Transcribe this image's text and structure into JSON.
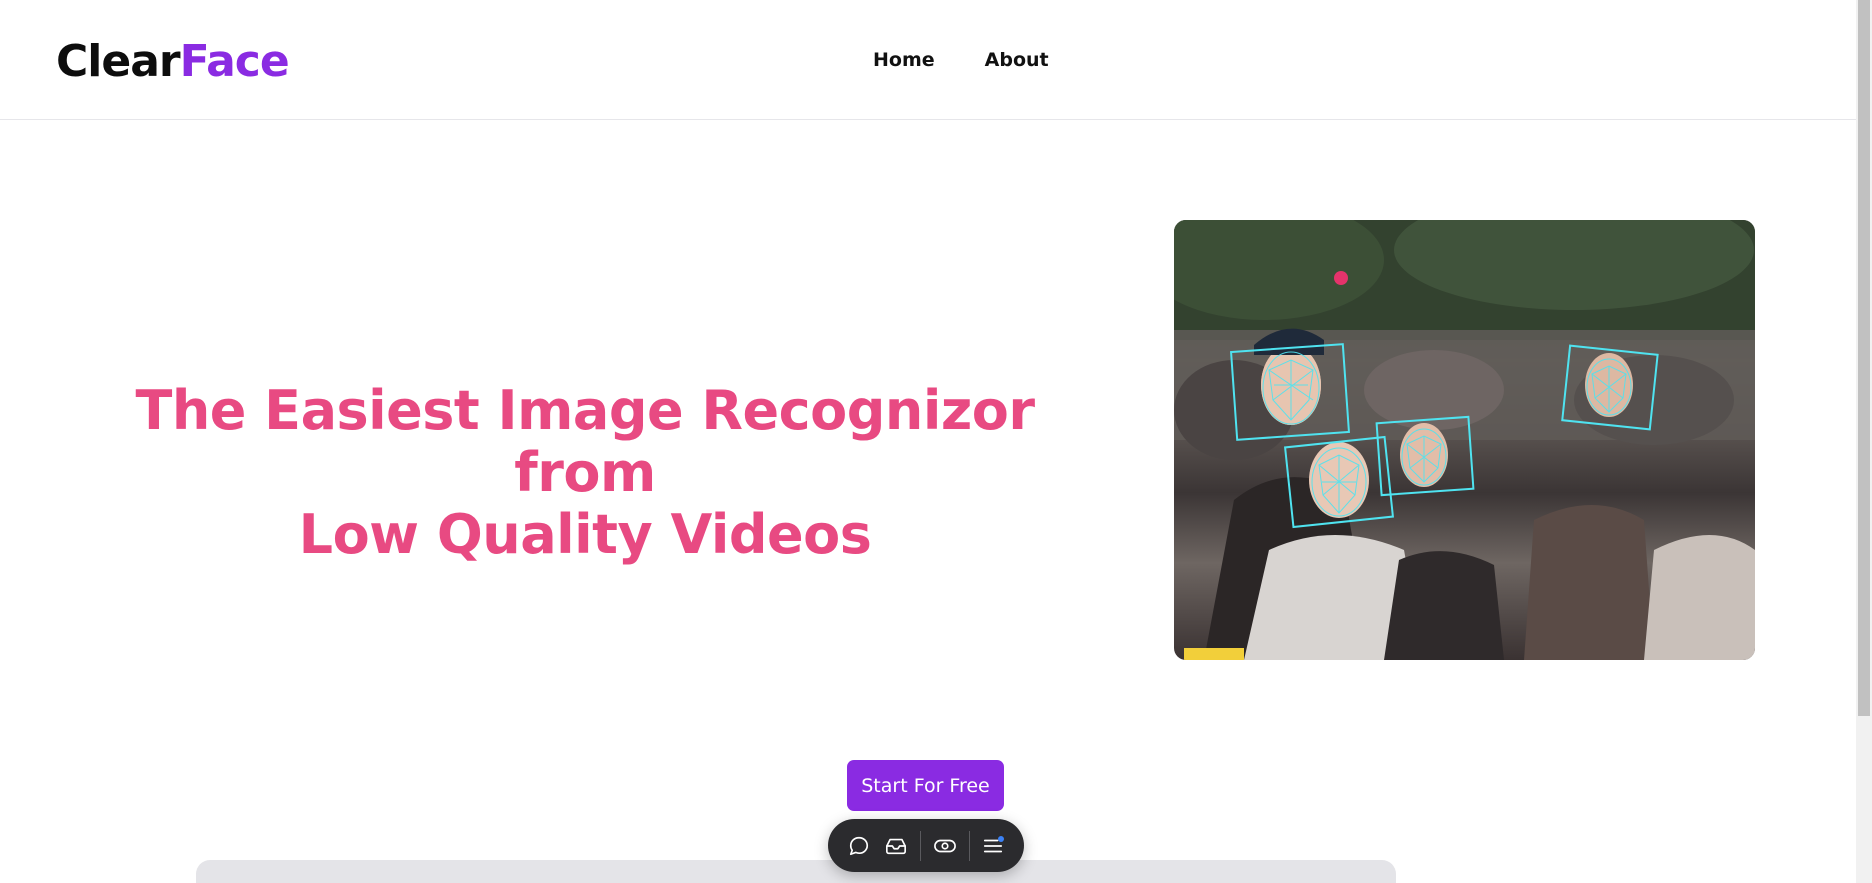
{
  "logo": {
    "part1": "Clear",
    "part2": "Face"
  },
  "nav": {
    "home": "Home",
    "about": "About"
  },
  "hero": {
    "title_line1": "The Easiest Image Recognizor from",
    "title_line2": "Low Quality Videos",
    "image_description": "",
    "cta_label": "Start For Free"
  },
  "toolbar": {
    "icons": [
      "chat-bubble-icon",
      "inbox-icon",
      "eye-icon",
      "menu-icon"
    ]
  },
  "colors": {
    "brand_purple": "#8a2be2",
    "title_pink": "#e84a82",
    "face_box_cyan": "#4fe3f0"
  }
}
